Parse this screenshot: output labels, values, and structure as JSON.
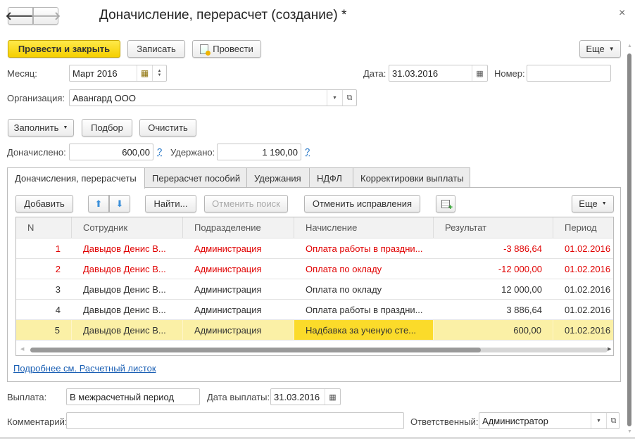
{
  "window": {
    "title": "Доначисление, перерасчет (создание) *",
    "close": "×"
  },
  "toolbar": {
    "post_close": "Провести и закрыть",
    "save": "Записать",
    "post": "Провести",
    "more": "Еще"
  },
  "header": {
    "month_label": "Месяц:",
    "month_value": "Март 2016",
    "date_label": "Дата:",
    "date_value": "31.03.2016",
    "number_label": "Номер:",
    "number_value": "",
    "org_label": "Организация:",
    "org_value": "Авангард ООО"
  },
  "actions": {
    "fill": "Заполнить",
    "pick": "Подбор",
    "clear": "Очистить"
  },
  "totals": {
    "accrued_label": "Доначислено:",
    "accrued_value": "600,00",
    "withheld_label": "Удержано:",
    "withheld_value": "1 190,00",
    "help": "?"
  },
  "tabs": [
    "Доначисления, перерасчеты",
    "Перерасчет пособий",
    "Удержания",
    "НДФЛ",
    "Корректировки выплаты"
  ],
  "table_toolbar": {
    "add": "Добавить",
    "find": "Найти...",
    "cancel_search": "Отменить поиск",
    "cancel_fixes": "Отменить исправления",
    "more": "Еще"
  },
  "table": {
    "columns": [
      "N",
      "Сотрудник",
      "Подразделение",
      "Начисление",
      "Результат",
      "Период"
    ],
    "rows": [
      {
        "n": "1",
        "employee": "Давыдов Денис В...",
        "dept": "Администрация",
        "accrual": "Оплата работы в праздни...",
        "result": "-3 886,64",
        "period": "01.02.2016",
        "status": "reversed"
      },
      {
        "n": "2",
        "employee": "Давыдов Денис В...",
        "dept": "Администрация",
        "accrual": "Оплата по окладу",
        "result": "-12 000,00",
        "period": "01.02.2016",
        "status": "reversed"
      },
      {
        "n": "3",
        "employee": "Давыдов Денис В...",
        "dept": "Администрация",
        "accrual": "Оплата по окладу",
        "result": "12 000,00",
        "period": "01.02.2016",
        "status": "normal"
      },
      {
        "n": "4",
        "employee": "Давыдов Денис В...",
        "dept": "Администрация",
        "accrual": "Оплата работы в праздни...",
        "result": "3 886,64",
        "period": "01.02.2016",
        "status": "normal"
      },
      {
        "n": "5",
        "employee": "Давыдов Денис В...",
        "dept": "Администрация",
        "accrual": "Надбавка за ученую сте...",
        "result": "600,00",
        "period": "01.02.2016",
        "status": "selected"
      }
    ]
  },
  "link": "Подробнее см. Расчетный листок",
  "footer": {
    "payout_label": "Выплата:",
    "payout_value": "В межрасчетный период",
    "payout_date_label": "Дата выплаты:",
    "payout_date_value": "31.03.2016",
    "comment_label": "Комментарий:",
    "comment_value": "",
    "responsible_label": "Ответственный:",
    "responsible_value": "Администратор"
  },
  "colors": {
    "accent": "#f5cf00",
    "reversed": "#e00000",
    "selected_row": "#fbf0a6",
    "current_cell": "#fbdb2a",
    "link": "#1a6fc4"
  }
}
